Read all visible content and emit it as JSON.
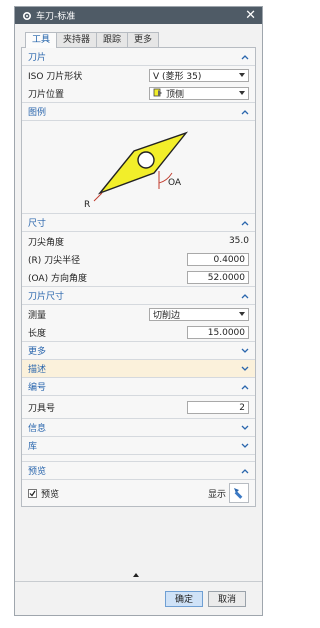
{
  "window": {
    "title": "车刀-标准",
    "close_glyph": "✕"
  },
  "tabs": [
    "工具",
    "夹持器",
    "跟踪",
    "更多"
  ],
  "sections": {
    "blade": {
      "title": "刀片",
      "iso_label": "ISO 刀片形状",
      "iso_value": "V (菱形 35)",
      "pos_label": "刀片位置",
      "pos_value": "顶侧"
    },
    "illustration": {
      "title": "图例",
      "label_oa": "OA",
      "label_r": "R"
    },
    "size": {
      "title": "尺寸",
      "tip_angle_label": "刀尖角度",
      "tip_angle_value": "35.0",
      "radius_label": "(R) 刀尖半径",
      "radius_value": "0.4000",
      "oa_label": "(OA) 方向角度",
      "oa_value": "52.0000"
    },
    "blade_size": {
      "title": "刀片尺寸",
      "measure_label": "测量",
      "measure_value": "切削边",
      "length_label": "长度",
      "length_value": "15.0000"
    },
    "more": {
      "title": "更多"
    },
    "description": {
      "title": "描述"
    },
    "number": {
      "title": "编号",
      "tool_no_label": "刀具号",
      "tool_no_value": "2"
    },
    "info": {
      "title": "信息"
    },
    "library": {
      "title": "库"
    },
    "preview": {
      "title": "预览",
      "checkbox_label": "预览",
      "show_label": "显示"
    }
  },
  "buttons": {
    "ok": "确定",
    "cancel": "取消"
  },
  "colors": {
    "titlebar": "#4f5b66",
    "section_header": "#2a66ad",
    "insert_fill": "#f2ee2a",
    "highlight_row": "#fbf1db"
  }
}
